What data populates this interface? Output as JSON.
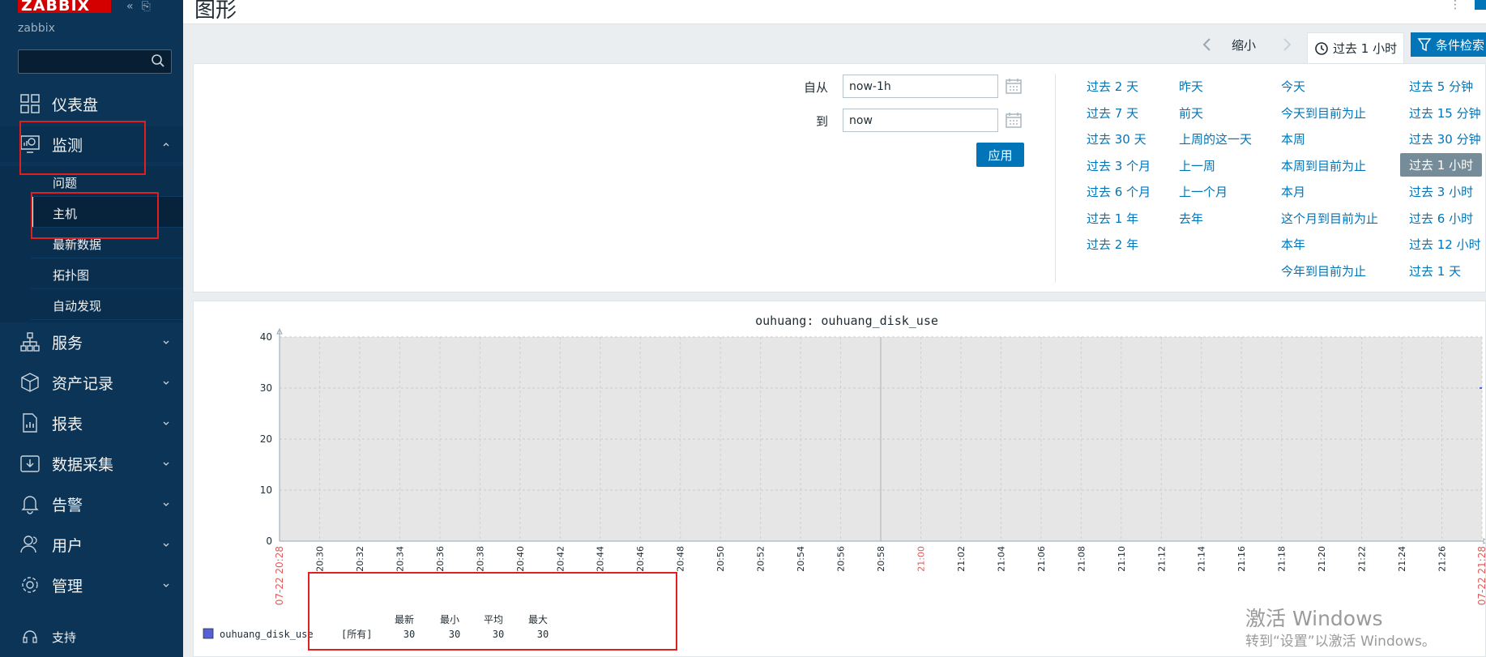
{
  "brand": {
    "logo_text": "ZABBIX",
    "server_name": "zabbix"
  },
  "sidebar": {
    "search_placeholder": "",
    "items": [
      {
        "label": "仪表盘",
        "icon": "dashboard-icon"
      },
      {
        "label": "监测",
        "icon": "monitoring-icon"
      },
      {
        "label": "服务",
        "icon": "services-icon"
      },
      {
        "label": "资产记录",
        "icon": "inventory-icon"
      },
      {
        "label": "报表",
        "icon": "reports-icon"
      },
      {
        "label": "数据采集",
        "icon": "data-collection-icon"
      },
      {
        "label": "告警",
        "icon": "alerts-icon"
      },
      {
        "label": "用户",
        "icon": "users-icon"
      },
      {
        "label": "管理",
        "icon": "administration-icon"
      }
    ],
    "submenu": [
      "问题",
      "主机",
      "最新数据",
      "拓扑图",
      "自动发现"
    ],
    "support_label": "支持"
  },
  "header": {
    "title": "图形"
  },
  "tabs": {
    "zoom_out": "缩小",
    "time_range": "过去 1 小时",
    "filter": "条件检索"
  },
  "filter": {
    "from_label": "自从",
    "from_value": "now-1h",
    "to_label": "到",
    "to_value": "now",
    "apply_label": "应用",
    "quick_ranges": [
      [
        "过去 2 天",
        "过去 7 天",
        "过去 30 天",
        "过去 3 个月",
        "过去 6 个月",
        "过去 1 年",
        "过去 2 年"
      ],
      [
        "昨天",
        "前天",
        "上周的这一天",
        "上一周",
        "上一个月",
        "去年"
      ],
      [
        "今天",
        "今天到目前为止",
        "本周",
        "本周到目前为止",
        "本月",
        "这个月到目前为止",
        "本年",
        "今年到目前为止"
      ],
      [
        "过去 5 分钟",
        "过去 15 分钟",
        "过去 30 分钟",
        "过去 1 小时",
        "过去 3 小时",
        "过去 6 小时",
        "过去 12 小时",
        "过去 1 天"
      ]
    ],
    "active_range": "过去 1 小时"
  },
  "chart_data": {
    "type": "line",
    "title": "ouhuang: ouhuang_disk_use",
    "ylim": [
      0,
      40
    ],
    "y_ticks": [
      0,
      10,
      20,
      30,
      40
    ],
    "x_ticks": [
      "20:30",
      "20:32",
      "20:34",
      "20:36",
      "20:38",
      "20:40",
      "20:42",
      "20:44",
      "20:46",
      "20:48",
      "20:50",
      "20:52",
      "20:54",
      "20:56",
      "20:58",
      "21:00",
      "21:02",
      "21:04",
      "21:06",
      "21:08",
      "21:10",
      "21:12",
      "21:14",
      "21:16",
      "21:18",
      "21:20",
      "21:22",
      "21:24",
      "21:26"
    ],
    "x_start": "07-22 20:28",
    "x_end": "07-22 21:28",
    "grid": true,
    "series": [
      {
        "name": "ouhuang_disk_use",
        "values": [
          30
        ],
        "color": "#5461d6"
      }
    ],
    "legend": {
      "headers": [
        "最新",
        "最小",
        "平均",
        "最大"
      ],
      "function": "[所有]",
      "values": [
        "30",
        "30",
        "30",
        "30"
      ]
    }
  },
  "watermark": {
    "line1": "激活 Windows",
    "line2": "转到“设置”以激活 Windows。"
  }
}
